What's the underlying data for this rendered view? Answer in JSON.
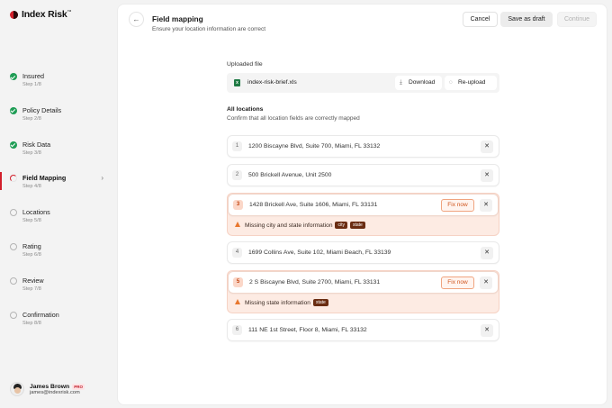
{
  "app": {
    "name": "Index Risk",
    "trademark": "™"
  },
  "sidebar": {
    "steps": [
      {
        "label": "Insured",
        "sub": "Step 1/8",
        "state": "done"
      },
      {
        "label": "Policy Details",
        "sub": "Step 2/8",
        "state": "done"
      },
      {
        "label": "Risk Data",
        "sub": "Step 3/8",
        "state": "done"
      },
      {
        "label": "Field Mapping",
        "sub": "Step 4/8",
        "state": "active"
      },
      {
        "label": "Locations",
        "sub": "Step 5/8",
        "state": "pending"
      },
      {
        "label": "Rating",
        "sub": "Step 6/8",
        "state": "pending"
      },
      {
        "label": "Review",
        "sub": "Step 7/8",
        "state": "pending"
      },
      {
        "label": "Confirmation",
        "sub": "Step 8/8",
        "state": "pending"
      }
    ],
    "user": {
      "name": "James Brown",
      "badge": "PRO",
      "email": "james@indexrisk.com"
    }
  },
  "header": {
    "back_icon": "arrow-left-icon",
    "title": "Field mapping",
    "subtitle": "Ensure your location information are correct",
    "cancel_label": "Cancel",
    "draft_label": "Save as draft",
    "continue_label": "Continue"
  },
  "upload": {
    "label": "Uploaded file",
    "file_name": "index-risk-brief.xls",
    "download_label": "Download",
    "reupload_label": "Re-upload"
  },
  "locations": {
    "title": "All locations",
    "subtitle": "Confirm that all location fields are correctly mapped",
    "fix_label": "Fix now",
    "items": [
      {
        "num": "1",
        "address": "1200 Biscayne Blvd, Suite 700, Miami, FL 33132",
        "error": null
      },
      {
        "num": "2",
        "address": "500 Brickell Avenue, Unit 2500",
        "error": null
      },
      {
        "num": "3",
        "address": "1428 Brickell Ave, Suite 1606, Miami, FL 33131",
        "error": {
          "text": "Missing city and state information",
          "tags": [
            "city",
            "state"
          ]
        }
      },
      {
        "num": "4",
        "address": "1699 Collins Ave, Suite 102, Miami Beach, FL 33139",
        "error": null
      },
      {
        "num": "5",
        "address": "2 S Biscayne Blvd, Suite 2700, Miami, FL 33131",
        "error": {
          "text": "Missing state information",
          "tags": [
            "state"
          ]
        }
      },
      {
        "num": "6",
        "address": "111 NE 1st Street, Floor 8, Miami, FL 33132",
        "error": null
      }
    ]
  },
  "colors": {
    "brand": "#d21f2b",
    "success": "#1f9d55",
    "warning": "#e8772e"
  }
}
